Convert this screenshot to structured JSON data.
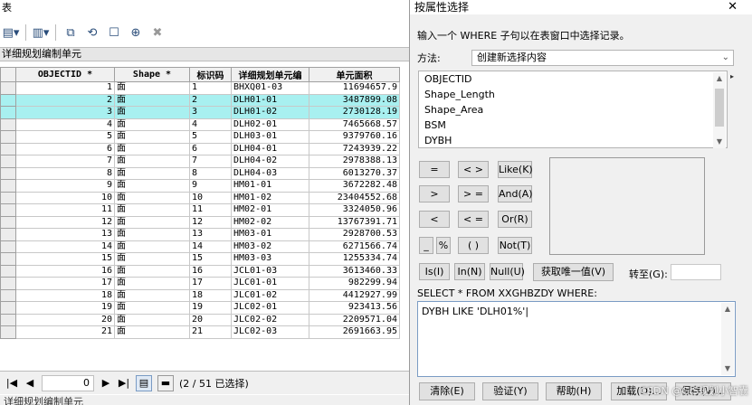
{
  "table_window": {
    "title": "表",
    "tab_header": "详细规划编制单元",
    "bottom_tab": "详细规划编制单元",
    "columns": [
      "OBJECTID *",
      "Shape *",
      "标识码",
      "详细规划单元编",
      "单元面积"
    ],
    "rows": [
      {
        "oid": "1",
        "shape": "面",
        "code": "1",
        "unit": "BHXQ01-03",
        "area": "11694657.9",
        "selected": false
      },
      {
        "oid": "2",
        "shape": "面",
        "code": "2",
        "unit": "DLH01-01",
        "area": "3487899.08",
        "selected": true
      },
      {
        "oid": "3",
        "shape": "面",
        "code": "3",
        "unit": "DLH01-02",
        "area": "2730128.19",
        "selected": true
      },
      {
        "oid": "4",
        "shape": "面",
        "code": "4",
        "unit": "DLH02-01",
        "area": "7465668.57",
        "selected": false
      },
      {
        "oid": "5",
        "shape": "面",
        "code": "5",
        "unit": "DLH03-01",
        "area": "9379760.16",
        "selected": false
      },
      {
        "oid": "6",
        "shape": "面",
        "code": "6",
        "unit": "DLH04-01",
        "area": "7243939.22",
        "selected": false
      },
      {
        "oid": "7",
        "shape": "面",
        "code": "7",
        "unit": "DLH04-02",
        "area": "2978388.13",
        "selected": false
      },
      {
        "oid": "8",
        "shape": "面",
        "code": "8",
        "unit": "DLH04-03",
        "area": "6013270.37",
        "selected": false
      },
      {
        "oid": "9",
        "shape": "面",
        "code": "9",
        "unit": "HM01-01",
        "area": "3672282.48",
        "selected": false
      },
      {
        "oid": "10",
        "shape": "面",
        "code": "10",
        "unit": "HM01-02",
        "area": "23404552.68",
        "selected": false
      },
      {
        "oid": "11",
        "shape": "面",
        "code": "11",
        "unit": "HM02-01",
        "area": "3324050.96",
        "selected": false
      },
      {
        "oid": "12",
        "shape": "面",
        "code": "12",
        "unit": "HM02-02",
        "area": "13767391.71",
        "selected": false
      },
      {
        "oid": "13",
        "shape": "面",
        "code": "13",
        "unit": "HM03-01",
        "area": "2928700.53",
        "selected": false
      },
      {
        "oid": "14",
        "shape": "面",
        "code": "14",
        "unit": "HM03-02",
        "area": "6271566.74",
        "selected": false
      },
      {
        "oid": "15",
        "shape": "面",
        "code": "15",
        "unit": "HM03-03",
        "area": "1255334.74",
        "selected": false
      },
      {
        "oid": "16",
        "shape": "面",
        "code": "16",
        "unit": "JCL01-03",
        "area": "3613460.33",
        "selected": false
      },
      {
        "oid": "17",
        "shape": "面",
        "code": "17",
        "unit": "JLC01-01",
        "area": "982299.94",
        "selected": false
      },
      {
        "oid": "18",
        "shape": "面",
        "code": "18",
        "unit": "JLC01-02",
        "area": "4412927.99",
        "selected": false
      },
      {
        "oid": "19",
        "shape": "面",
        "code": "19",
        "unit": "JLC02-01",
        "area": "923413.56",
        "selected": false
      },
      {
        "oid": "20",
        "shape": "面",
        "code": "20",
        "unit": "JLC02-02",
        "area": "2209571.04",
        "selected": false
      },
      {
        "oid": "21",
        "shape": "面",
        "code": "21",
        "unit": "JLC02-03",
        "area": "2691663.95",
        "selected": false
      }
    ],
    "record_value": "0",
    "selection_status": "(2 / 51 已选择)",
    "nav_first": "|◀",
    "nav_prev": "◀",
    "nav_next": "▶",
    "nav_last": "▶|",
    "selection_color": "#a8f0f0"
  },
  "dialog": {
    "title": "按属性选择",
    "close": "✕",
    "instruction": "输入一个 WHERE 子句以在表窗口中选择记录。",
    "method_label": "方法:",
    "method_value": "创建新选择内容",
    "fields": [
      "OBJECTID",
      "Shape_Length",
      "Shape_Area",
      "BSM",
      "DYBH"
    ],
    "operators": {
      "eq": "=",
      "ne": "< >",
      "like": "Like(K)",
      "gt": ">",
      "ge": "> =",
      "and": "And(A)",
      "lt": "<",
      "le": "< =",
      "or": "Or(R)",
      "underscore": "_",
      "percent": "%",
      "parens": "( )",
      "not": "Not(T)",
      "is": "Is(I)",
      "in": "In(N)",
      "null": "Null(U)"
    },
    "unique_values": "获取唯一值(V)",
    "goto_label": "转至(G):",
    "sql_prefix": "SELECT * FROM XXGHBZDY WHERE:",
    "sql_text": "DYBH LIKE 'DLH01%'",
    "buttons": {
      "clear": "清除(E)",
      "verify": "验证(Y)",
      "help": "帮助(H)",
      "load": "加载(D)...",
      "save": "保存(V)..."
    },
    "watermark": "CSDN @GIS规划小智囊"
  }
}
